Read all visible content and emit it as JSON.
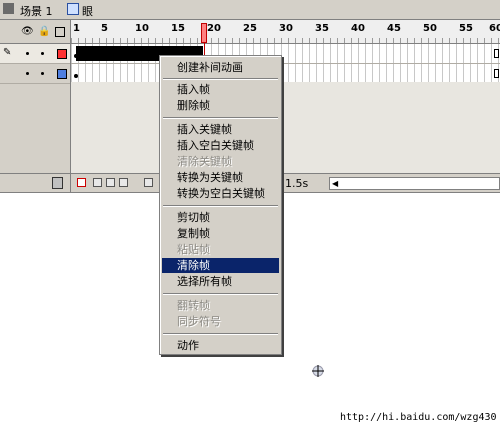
{
  "scene": {
    "label": "场景 1",
    "symbol": "眼"
  },
  "ruler": {
    "numbers": [
      "1",
      "5",
      "10",
      "15",
      "20",
      "25",
      "30",
      "35",
      "40",
      "45",
      "50",
      "55",
      "60"
    ]
  },
  "timeline": {
    "time": "1.5s"
  },
  "menu": {
    "items": [
      {
        "label": "创建补间动画",
        "enabled": true
      },
      {
        "label": "插入帧",
        "enabled": true
      },
      {
        "label": "删除帧",
        "enabled": true
      },
      {
        "label": "插入关键帧",
        "enabled": true
      },
      {
        "label": "插入空白关键帧",
        "enabled": true
      },
      {
        "label": "清除关键帧",
        "enabled": false
      },
      {
        "label": "转换为关键帧",
        "enabled": true
      },
      {
        "label": "转换为空白关键帧",
        "enabled": true
      },
      {
        "label": "剪切帧",
        "enabled": true
      },
      {
        "label": "复制帧",
        "enabled": true
      },
      {
        "label": "粘贴帧",
        "enabled": false
      },
      {
        "label": "清除帧",
        "enabled": true,
        "highlighted": true
      },
      {
        "label": "选择所有帧",
        "enabled": true
      },
      {
        "label": "翻转帧",
        "enabled": false
      },
      {
        "label": "同步符号",
        "enabled": false
      },
      {
        "label": "动作",
        "enabled": true
      }
    ]
  },
  "watermark": "http://hi.baidu.com/wzg430",
  "colors": {
    "highlight": "#0a246a",
    "layer1": "#ff3333",
    "layer2": "#4f7fe0"
  }
}
